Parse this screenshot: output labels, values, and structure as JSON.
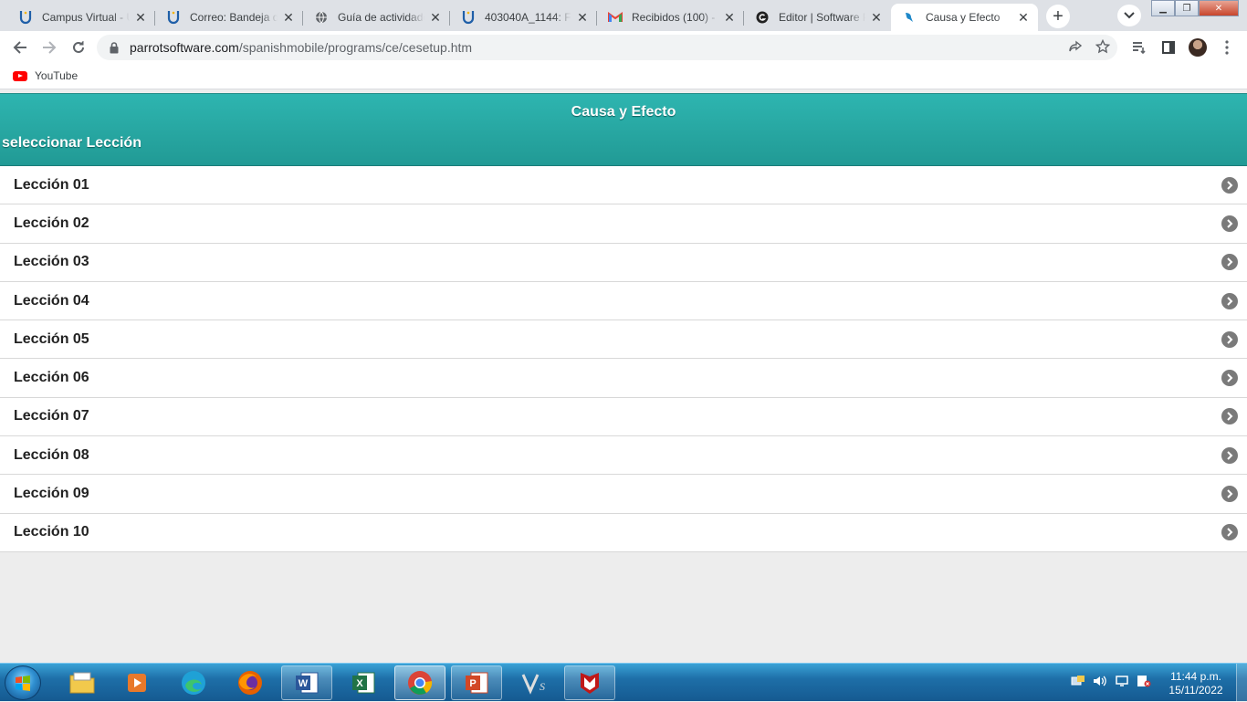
{
  "browser": {
    "tabs": [
      {
        "title": "Campus Virtual - U",
        "icon": "u-logo-icon"
      },
      {
        "title": "Correo: Bandeja d",
        "icon": "u-logo-icon"
      },
      {
        "title": "Guía de actividade",
        "icon": "globe-icon"
      },
      {
        "title": "403040A_1144: Fo",
        "icon": "u-logo-icon"
      },
      {
        "title": "Recibidos (100) - c",
        "icon": "gmail-icon"
      },
      {
        "title": "Editor | Software P",
        "icon": "grammarly-icon"
      },
      {
        "title": "Causa y Efecto",
        "icon": "parrot-icon",
        "active": true
      }
    ],
    "address": {
      "domain": "parrotsoftware.com",
      "path": "/spanishmobile/programs/ce/cesetup.htm"
    },
    "bookmarks": [
      {
        "label": "YouTube",
        "icon": "youtube-icon"
      }
    ]
  },
  "page": {
    "title": "Causa y Efecto",
    "subtitle": "seleccionar Lección",
    "lessons": [
      "Lección 01",
      "Lección 02",
      "Lección 03",
      "Lección 04",
      "Lección 05",
      "Lección 06",
      "Lección 07",
      "Lección 08",
      "Lección 09",
      "Lección 10"
    ],
    "header_color": "#2ab0ab"
  },
  "taskbar": {
    "apps": [
      "explorer",
      "media-player",
      "edge",
      "firefox",
      "word",
      "excel",
      "chrome",
      "powerpoint",
      "vs",
      "mcafee"
    ],
    "time": "11:44 p.m.",
    "date": "15/11/2022"
  }
}
